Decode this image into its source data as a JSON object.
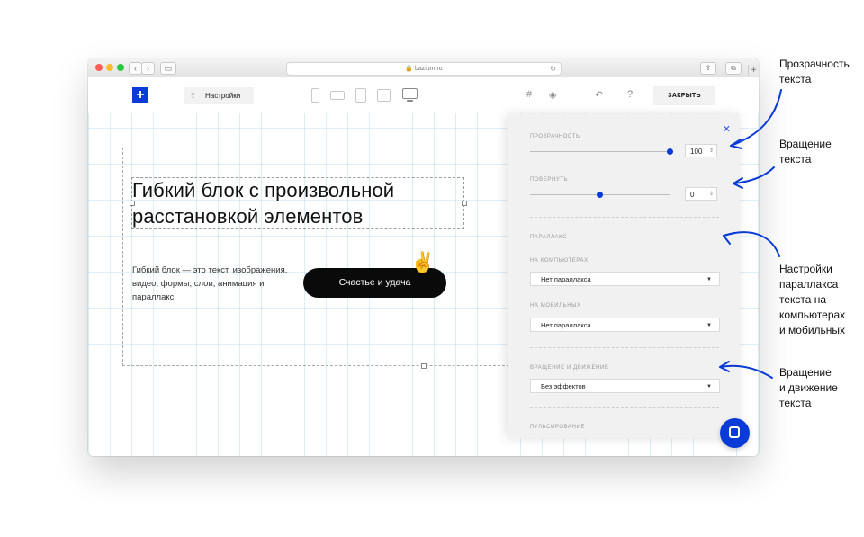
{
  "browser": {
    "url": "bazium.ru",
    "back_glyph": "‹",
    "forward_glyph": "›",
    "reload_glyph": "↻",
    "new_tab_glyph": "+"
  },
  "toolbar": {
    "add_glyph": "+",
    "settings_label": "Настройки",
    "close_label": "ЗАКРЫТЬ",
    "help_glyph": "?",
    "undo_glyph": "↶",
    "grid_glyph": "#",
    "layers_glyph": "◈",
    "devices": [
      "phone-portrait-icon",
      "phone-landscape-icon",
      "tablet-portrait-icon",
      "tablet-landscape-icon",
      "desktop-icon"
    ]
  },
  "canvas": {
    "heading": "Гибкий блок с произвольной расстановкой элементов",
    "description": "Гибкий блок — это текст, изображения, видео, формы, слои, анимация и параллакс",
    "button_label": "Счастье и удача",
    "emoji": "✌"
  },
  "panel": {
    "close_glyph": "✕",
    "opacity_label": "ПРОЗРАЧНОСТЬ",
    "opacity_value": "100",
    "opacity_level": 1.0,
    "rotate_label": "ПОВЕРНУТЬ",
    "rotate_value": "0",
    "rotate_level": 0.5,
    "parallax_label": "ПАРАЛЛАКС",
    "desktop_label": "НА КОМПЬЮТЕРАХ",
    "desktop_value": "Нет параллакса",
    "mobile_label": "НА МОБИЛЬНЫХ",
    "mobile_value": "Нет параллакса",
    "motion_label": "ВРАЩЕНИЕ И ДВИЖЕНИЕ",
    "motion_value": "Без эффектов",
    "pulse_label": "ПУЛЬСИРОВАНИЕ",
    "spinner_glyph": "⇕",
    "caret_glyph": "▼"
  },
  "annotations": {
    "opacity": [
      "Прозрачность",
      "текста"
    ],
    "rotation": [
      "Вращение",
      "текста"
    ],
    "parallax": [
      "Настройки",
      "параллакса",
      "текста на",
      "компьютерах",
      "и мобильных"
    ],
    "motion": [
      "Вращение",
      "и движение",
      "текста"
    ]
  },
  "colors": {
    "accent": "#0b3bd6",
    "panel_bg": "#f1f1f1",
    "button_bg": "#0a0a0a"
  }
}
